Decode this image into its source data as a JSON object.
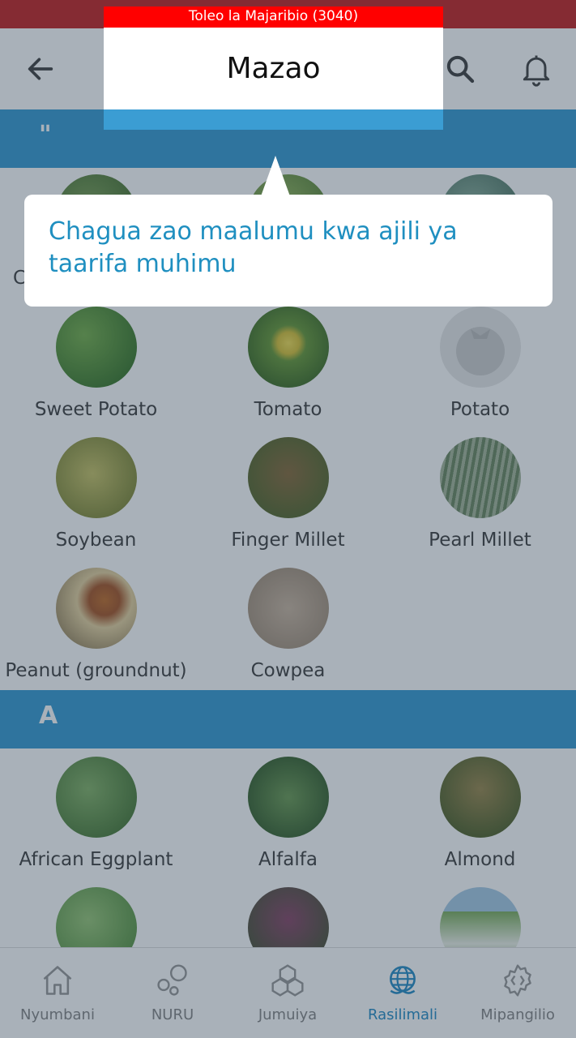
{
  "appbar": {
    "title": "Mazao"
  },
  "build_banner": "Toleo la Majaribio (3040)",
  "tooltip": {
    "text": "Chagua zao maalumu kwa ajili ya taarifa muhimu"
  },
  "sections": {
    "popular": {
      "label": "\""
    },
    "a": {
      "label": "A"
    }
  },
  "partial_label": "C",
  "crops": [
    {
      "name": "Sweet Potato"
    },
    {
      "name": "Tomato"
    },
    {
      "name": "Potato"
    },
    {
      "name": "Soybean"
    },
    {
      "name": "Finger Millet"
    },
    {
      "name": "Pearl Millet"
    },
    {
      "name": "Peanut (groundnut)"
    },
    {
      "name": "Cowpea"
    },
    {
      "name": "African Eggplant"
    },
    {
      "name": "Alfalfa"
    },
    {
      "name": "Almond"
    }
  ],
  "bottom_nav": [
    {
      "label": "Nyumbani",
      "icon": "home-icon",
      "active": false
    },
    {
      "label": "NURU",
      "icon": "bubbles-icon",
      "active": false
    },
    {
      "label": "Jumuiya",
      "icon": "community-icon",
      "active": false
    },
    {
      "label": "Rasilimali",
      "icon": "globe-icon",
      "active": true
    },
    {
      "label": "Mipangilio",
      "icon": "gear-icon",
      "active": false
    }
  ],
  "colors": {
    "accent": "#3b9dd3",
    "status": "#c62828",
    "banner": "#ff0000",
    "tooltip_text": "#1f8fc0"
  }
}
